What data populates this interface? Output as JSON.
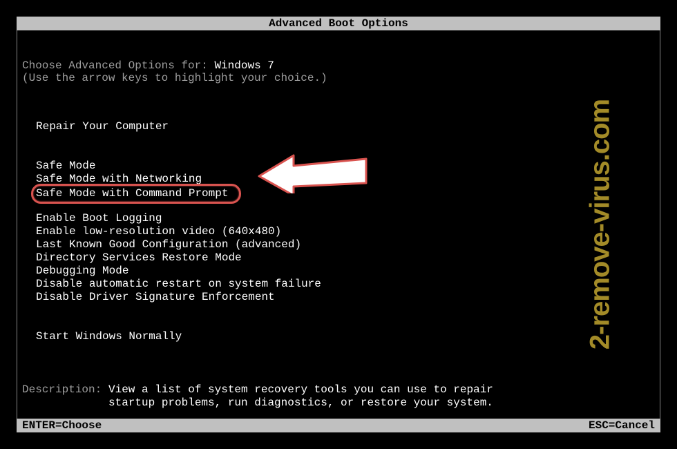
{
  "title": "Advanced Boot Options",
  "prompt": {
    "prefix": "Choose Advanced Options for: ",
    "os": "Windows 7",
    "hint": "(Use the arrow keys to highlight your choice.)"
  },
  "menu": {
    "repair": "Repair Your Computer",
    "safe_mode": "Safe Mode",
    "safe_mode_net": "Safe Mode with Networking",
    "safe_mode_cmd": "Safe Mode with Command Prompt",
    "boot_log": "Enable Boot Logging",
    "low_res": "Enable low-resolution video (640x480)",
    "lkgc": "Last Known Good Configuration (advanced)",
    "ds_restore": "Directory Services Restore Mode",
    "debug": "Debugging Mode",
    "no_auto_restart": "Disable automatic restart on system failure",
    "no_sig_enforce": "Disable Driver Signature Enforcement",
    "start_normal": "Start Windows Normally"
  },
  "description": {
    "label": "Description:",
    "text": "View a list of system recovery tools you can use to repair\nstartup problems, run diagnostics, or restore your system."
  },
  "footer": {
    "enter": "ENTER=Choose",
    "esc": "ESC=Cancel"
  },
  "watermark": "2-remove-virus.com"
}
